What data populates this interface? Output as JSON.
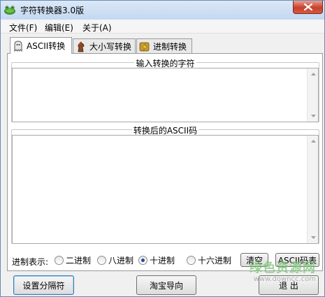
{
  "window": {
    "title": "字符转换器3.0版",
    "icon": "frog-icon"
  },
  "menu": [
    {
      "label": "文件(F)"
    },
    {
      "label": "编辑(E)"
    },
    {
      "label": "关于(A)"
    }
  ],
  "tabs": [
    {
      "label": "ASCII转换",
      "icon": "ghost-icon",
      "active": true
    },
    {
      "label": "大小写转换",
      "icon": "horse-icon",
      "active": false
    },
    {
      "label": "进制转换",
      "icon": "lightning-icon",
      "active": false
    }
  ],
  "input_group": {
    "title": "输入转换的字符",
    "value": ""
  },
  "output_group": {
    "title": "转换后的ASCII码",
    "value": ""
  },
  "radix": {
    "label": "进制表示:",
    "options": [
      {
        "label": "二进制",
        "selected": false
      },
      {
        "label": "八进制",
        "selected": false
      },
      {
        "label": "十进制",
        "selected": true
      },
      {
        "label": "十六进制",
        "selected": false
      }
    ]
  },
  "buttons": {
    "clear": "清空",
    "ascii_table": "ASCII码表",
    "set_separator": "设置分隔符",
    "taobao": "淘宝导向",
    "exit": "退 出"
  },
  "watermark": {
    "main": "绿色资源网",
    "sub": "www.downcc.com"
  }
}
